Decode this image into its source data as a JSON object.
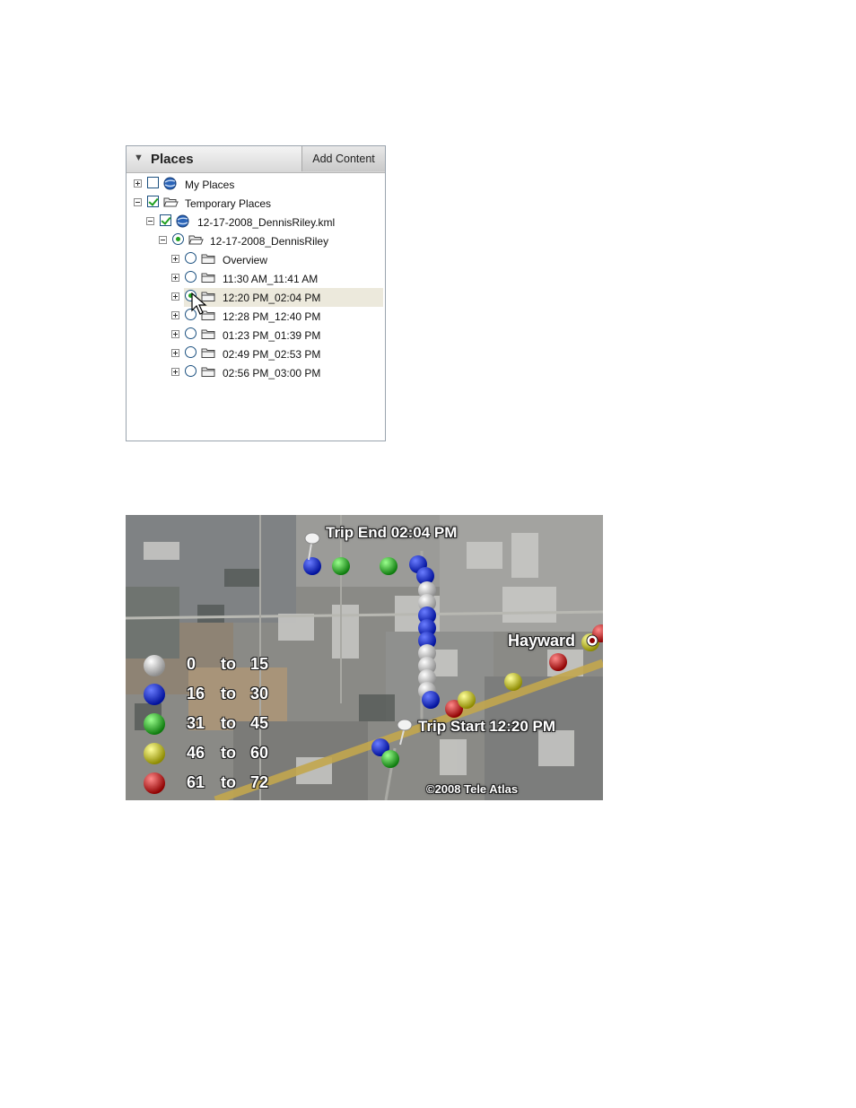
{
  "places": {
    "title": "Places",
    "add_content": "Add Content",
    "items": [
      {
        "label": "My Places",
        "expander": "plus",
        "control": "checkbox",
        "checked": false,
        "icon": "globe-icon"
      },
      {
        "label": "Temporary Places",
        "expander": "minus",
        "control": "checkbox",
        "checked": true,
        "icon": "open-folder-icon"
      },
      {
        "label": "12-17-2008_DennisRiley.kml",
        "expander": "minus",
        "control": "checkbox",
        "checked": true,
        "icon": "globe-icon"
      },
      {
        "label": "12-17-2008_DennisRiley",
        "expander": "minus",
        "control": "radio",
        "checked": true,
        "icon": "open-folder-icon"
      },
      {
        "label": "Overview",
        "expander": "plus",
        "control": "radio",
        "checked": false,
        "icon": "folder-icon"
      },
      {
        "label": "11:30 AM_11:41 AM",
        "expander": "plus",
        "control": "radio",
        "checked": false,
        "icon": "folder-icon"
      },
      {
        "label": "12:20 PM_02:04 PM",
        "expander": "plus",
        "control": "radio",
        "checked": true,
        "icon": "folder-icon",
        "highlighted": true
      },
      {
        "label": "12:28 PM_12:40 PM",
        "expander": "plus",
        "control": "radio",
        "checked": false,
        "icon": "folder-icon"
      },
      {
        "label": "01:23 PM_01:39 PM",
        "expander": "plus",
        "control": "radio",
        "checked": false,
        "icon": "folder-icon"
      },
      {
        "label": "02:49 PM_02:53 PM",
        "expander": "plus",
        "control": "radio",
        "checked": false,
        "icon": "folder-icon"
      },
      {
        "label": "02:56 PM_03:00 PM",
        "expander": "plus",
        "control": "radio",
        "checked": false,
        "icon": "folder-icon"
      }
    ]
  },
  "map": {
    "trip_end": "Trip End 02:04 PM",
    "trip_start": "Trip Start 12:20 PM",
    "city": "Hayward",
    "copyright": "©2008 Tele Atlas",
    "legend": [
      {
        "from": "0",
        "to_word": "to",
        "to": "15",
        "color": "#d9d9d9"
      },
      {
        "from": "16",
        "to_word": "to",
        "to": "30",
        "color": "#0b22d6"
      },
      {
        "from": "31",
        "to_word": "to",
        "to": "45",
        "color": "#1fb51f"
      },
      {
        "from": "46",
        "to_word": "to",
        "to": "60",
        "color": "#d8d21a"
      },
      {
        "from": "61",
        "to_word": "to",
        "to": "72",
        "color": "#e01313"
      }
    ]
  }
}
